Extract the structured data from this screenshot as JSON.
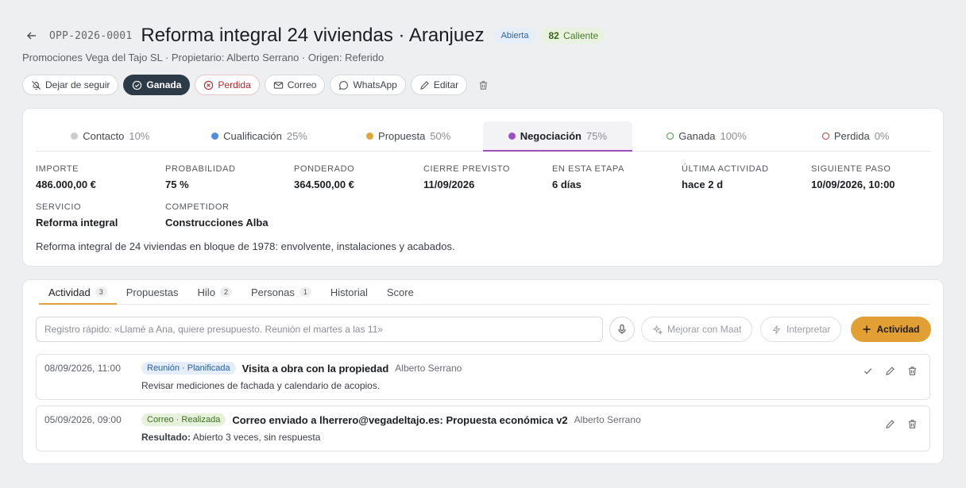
{
  "header": {
    "code": "OPP-2026-0001",
    "title": "Reforma integral 24 viviendas · Aranjuez",
    "status_badge": "Abierta",
    "score_value": "82",
    "score_label": "Caliente",
    "subtitle": "Promociones Vega del Tajo SL · Propietario: Alberto Serrano · Origen: Referido"
  },
  "actions": {
    "unfollow": "Dejar de seguir",
    "won": "Ganada",
    "lost": "Perdida",
    "email": "Correo",
    "whatsapp": "WhatsApp",
    "edit": "Editar"
  },
  "stages": [
    {
      "label": "Contacto",
      "pct": "10%",
      "color": "#c9cbd0",
      "style": "filled"
    },
    {
      "label": "Cualificación",
      "pct": "25%",
      "color": "#4f8ee0",
      "style": "filled"
    },
    {
      "label": "Propuesta",
      "pct": "50%",
      "color": "#e4a43c",
      "style": "filled"
    },
    {
      "label": "Negociación",
      "pct": "75%",
      "color": "#9b4fc2",
      "style": "filled"
    },
    {
      "label": "Ganada",
      "pct": "100%",
      "color": "#3c9a3c",
      "style": "ring"
    },
    {
      "label": "Perdida",
      "pct": "0%",
      "color": "#b03a3a",
      "style": "ring"
    }
  ],
  "fields": [
    {
      "label": "Importe",
      "value": "486.000,00 €"
    },
    {
      "label": "Probabilidad",
      "value": "75 %"
    },
    {
      "label": "Ponderado",
      "value": "364.500,00 €"
    },
    {
      "label": "Cierre previsto",
      "value": "11/09/2026"
    },
    {
      "label": "En esta etapa",
      "value": "6 días"
    },
    {
      "label": "Última actividad",
      "value": "hace 2 d"
    },
    {
      "label": "Siguiente paso",
      "value": "10/09/2026, 10:00"
    },
    {
      "label": "Servicio",
      "value": "Reforma integral"
    },
    {
      "label": "Competidor",
      "value": "Construcciones Alba"
    }
  ],
  "description": "Reforma integral de 24 viviendas en bloque de 1978: envolvente, instalaciones y acabados.",
  "tabs": [
    {
      "label": "Actividad",
      "count": "3"
    },
    {
      "label": "Propuestas",
      "count": ""
    },
    {
      "label": "Hilo",
      "count": "2"
    },
    {
      "label": "Personas",
      "count": "1"
    },
    {
      "label": "Historial",
      "count": ""
    },
    {
      "label": "Score",
      "count": ""
    }
  ],
  "quick_entry": {
    "placeholder": "Registro rápido: «Llamé a Ana, quiere presupuesto. Reunión el martes a las 11»"
  },
  "buttons": {
    "improve": "Mejorar con Maat",
    "interpret": "Interpretar",
    "add_activity": "Actividad"
  },
  "activities": [
    {
      "when": "08/09/2026, 11:00",
      "tag": "Reunión · Planificada",
      "title": "Visita a obra con la propiedad",
      "who": "Alberto Serrano",
      "detail_label": "",
      "detail": "Revisar mediciones de fachada y calendario de acopios."
    },
    {
      "when": "05/09/2026, 09:00",
      "tag": "Correo · Realizada",
      "title": "Correo enviado a lherrero@vegadeltajo.es: Propuesta económica v2",
      "who": "Alberto Serrano",
      "detail_label": "Resultado:",
      "detail": "Abierto 3 veces, sin respuesta"
    }
  ]
}
